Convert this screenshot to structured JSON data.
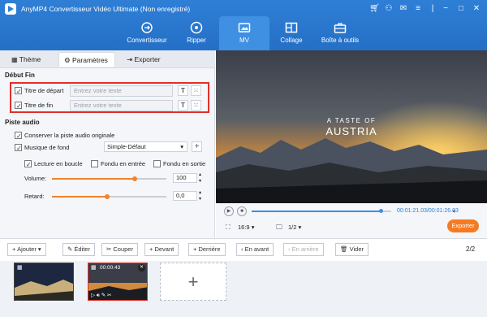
{
  "app": {
    "title": "AnyMP4 Convertisseur Vidéo Ultimate (Non enregistré)"
  },
  "nav": [
    {
      "label": "Convertisseur"
    },
    {
      "label": "Ripper"
    },
    {
      "label": "MV"
    },
    {
      "label": "Collage"
    },
    {
      "label": "Boîte à outils"
    }
  ],
  "tabs": {
    "theme": "Thème",
    "params": "Paramètres",
    "export": "Exporter"
  },
  "debut_fin": {
    "section": "Début Fin",
    "start_label": "Titre de départ",
    "start_placeholder": "Entrez votre texte",
    "end_label": "Titre de fin",
    "end_placeholder": "Entrez votre texte",
    "text_btn": "T",
    "start_checked": true,
    "end_checked": true
  },
  "audio": {
    "section": "Piste audio",
    "keep_original": "Conserver la piste audio originale",
    "bg_music": "Musique de fond",
    "music_value": "Simple-Défaut",
    "plus": "+",
    "loop": "Lecture en boucle",
    "fade_in": "Fondu en entrée",
    "fade_out": "Fondu en sortie",
    "volume_label": "Volume:",
    "volume_value": "100",
    "volume_fraction": 0.72,
    "delay_label": "Retard:",
    "delay_value": "0,0",
    "delay_fraction": 0.48
  },
  "preview": {
    "overlay_line1": "A TASTE OF",
    "overlay_line2": "AUSTRIA"
  },
  "player": {
    "time": "00:01:21.03/00:01:26.03",
    "progress": 0.93,
    "ratio": "16:9",
    "page": "1/2",
    "export": "Exporter"
  },
  "toolbar": {
    "add": "Ajouter",
    "edit": "Éditer",
    "cut": "Couper",
    "front": "Devant",
    "back": "Derrière",
    "forward": "En avant",
    "backward": "En arrière",
    "clear": "Vider",
    "count": "2/2"
  },
  "clips": [
    {
      "time": ""
    },
    {
      "time": "00:00:43"
    }
  ],
  "colors": {
    "brand": "#2f7fd6",
    "accent": "#f57b22",
    "highlight": "#e0302c"
  }
}
